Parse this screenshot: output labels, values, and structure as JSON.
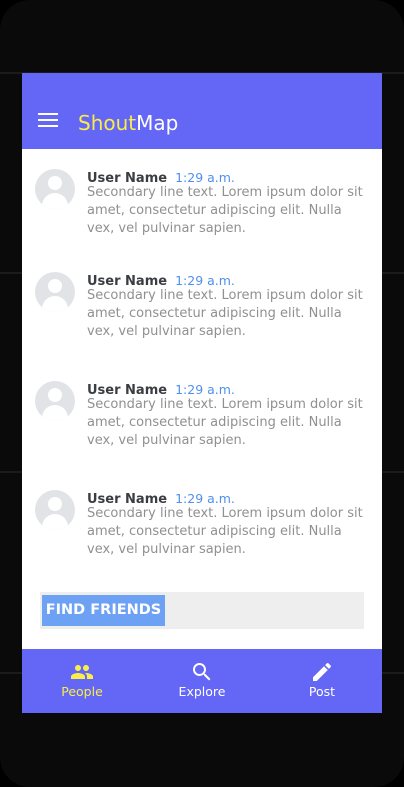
{
  "app": {
    "title_part1": "Shout",
    "title_part2": "Map",
    "accent_color": "#6467f5",
    "highlight_color": "#f9ee49"
  },
  "feed": [
    {
      "user": "User Name",
      "time": "1:29 a.m.",
      "text": "Secondary line text. Lorem ipsum dolor sit amet, consectetur adipiscing elit. Nulla vex, vel pulvinar sapien."
    },
    {
      "user": "User Name",
      "time": "1:29 a.m.",
      "text": "Secondary line text. Lorem ipsum dolor sit amet, consectetur adipiscing elit. Nulla vex, vel pulvinar sapien."
    },
    {
      "user": "User Name",
      "time": "1:29 a.m.",
      "text": "Secondary line text. Lorem ipsum dolor sit amet, consectetur adipiscing elit. Nulla vex, vel pulvinar sapien."
    },
    {
      "user": "User Name",
      "time": "1:29 a.m.",
      "text": "Secondary line text. Lorem ipsum dolor sit amet, consectetur adipiscing elit. Nulla vex, vel pulvinar sapien."
    }
  ],
  "find_friends": {
    "label": "FIND FRIENDS"
  },
  "bottom_nav": [
    {
      "label": "People",
      "icon": "people-icon",
      "active": true
    },
    {
      "label": "Explore",
      "icon": "search-icon",
      "active": false
    },
    {
      "label": "Post",
      "icon": "pencil-icon",
      "active": false
    }
  ]
}
